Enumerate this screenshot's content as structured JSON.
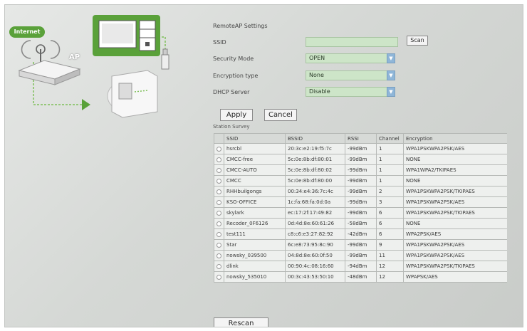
{
  "diagram": {
    "internet_label": "Internet",
    "ap_label": "AP",
    "colors": {
      "accent": "#5aa13a",
      "line": "#7fbf5a"
    }
  },
  "form": {
    "title": "RemoteAP Settings",
    "ssid_label": "SSID",
    "ssid_value": "",
    "scan_label": "Scan",
    "security_mode_label": "Security Mode",
    "security_mode_value": "OPEN",
    "encryption_type_label": "Encryption type",
    "encryption_type_value": "None",
    "dhcp_label": "DHCP Server",
    "dhcp_value": "Disable",
    "apply_label": "Apply",
    "cancel_label": "Cancel"
  },
  "status_label": "Station Survey",
  "table": {
    "headers": [
      "",
      "SSID",
      "BSSID",
      "RSSI",
      "Channel",
      "Encryption"
    ],
    "rows": [
      {
        "ssid": "hsrcbl",
        "bssid": "20:3c:e2:19:f5:7c",
        "rssi": "-99dBm",
        "channel": "1",
        "enc": "WPA1PSKWPA2PSK/AES"
      },
      {
        "ssid": "CMCC-free",
        "bssid": "5c:0e:8b:df:80:01",
        "rssi": "-99dBm",
        "channel": "1",
        "enc": "NONE"
      },
      {
        "ssid": "CMCC-AUTO",
        "bssid": "5c:0e:8b:df:80:02",
        "rssi": "-99dBm",
        "channel": "1",
        "enc": "WPA1WPA2/TKIPAES"
      },
      {
        "ssid": "CMCC",
        "bssid": "5c:0e:8b:df:80:00",
        "rssi": "-99dBm",
        "channel": "1",
        "enc": "NONE"
      },
      {
        "ssid": "RHHbuilgongs",
        "bssid": "00:34:e4:36:7c:4c",
        "rssi": "-99dBm",
        "channel": "2",
        "enc": "WPA1PSKWPA2PSK/TKIPAES"
      },
      {
        "ssid": "KSO-OFFICE",
        "bssid": "1c:fa:68:fa:0d:0a",
        "rssi": "-99dBm",
        "channel": "3",
        "enc": "WPA1PSKWPA2PSK/AES"
      },
      {
        "ssid": "skylark",
        "bssid": "ec:17:2f:17:49:82",
        "rssi": "-99dBm",
        "channel": "6",
        "enc": "WPA1PSKWPA2PSK/TKIPAES"
      },
      {
        "ssid": "Recoder_0F6126",
        "bssid": "0d:4d:8e:60:61:26",
        "rssi": "-58dBm",
        "channel": "6",
        "enc": "NONE"
      },
      {
        "ssid": "test111",
        "bssid": "c8:c6:e3:27:82:92",
        "rssi": "-42dBm",
        "channel": "6",
        "enc": "WPA2PSK/AES"
      },
      {
        "ssid": "Star",
        "bssid": "6c:e8:73:95:8c:90",
        "rssi": "-99dBm",
        "channel": "9",
        "enc": "WPA1PSKWPA2PSK/AES"
      },
      {
        "ssid": "nowsky_039500",
        "bssid": "04:8d:8e:60:0f:50",
        "rssi": "-99dBm",
        "channel": "11",
        "enc": "WPA1PSKWPA2PSK/AES"
      },
      {
        "ssid": "dlink",
        "bssid": "00:90:4c:08:16:60",
        "rssi": "-94dBm",
        "channel": "12",
        "enc": "WPA1PSKWPA2PSK/TKIPAES"
      },
      {
        "ssid": "nowsky_535010",
        "bssid": "00:3c:43:53:50:10",
        "rssi": "-48dBm",
        "channel": "12",
        "enc": "WPAPSK/AES"
      }
    ]
  },
  "rescan_label": "Rescan"
}
